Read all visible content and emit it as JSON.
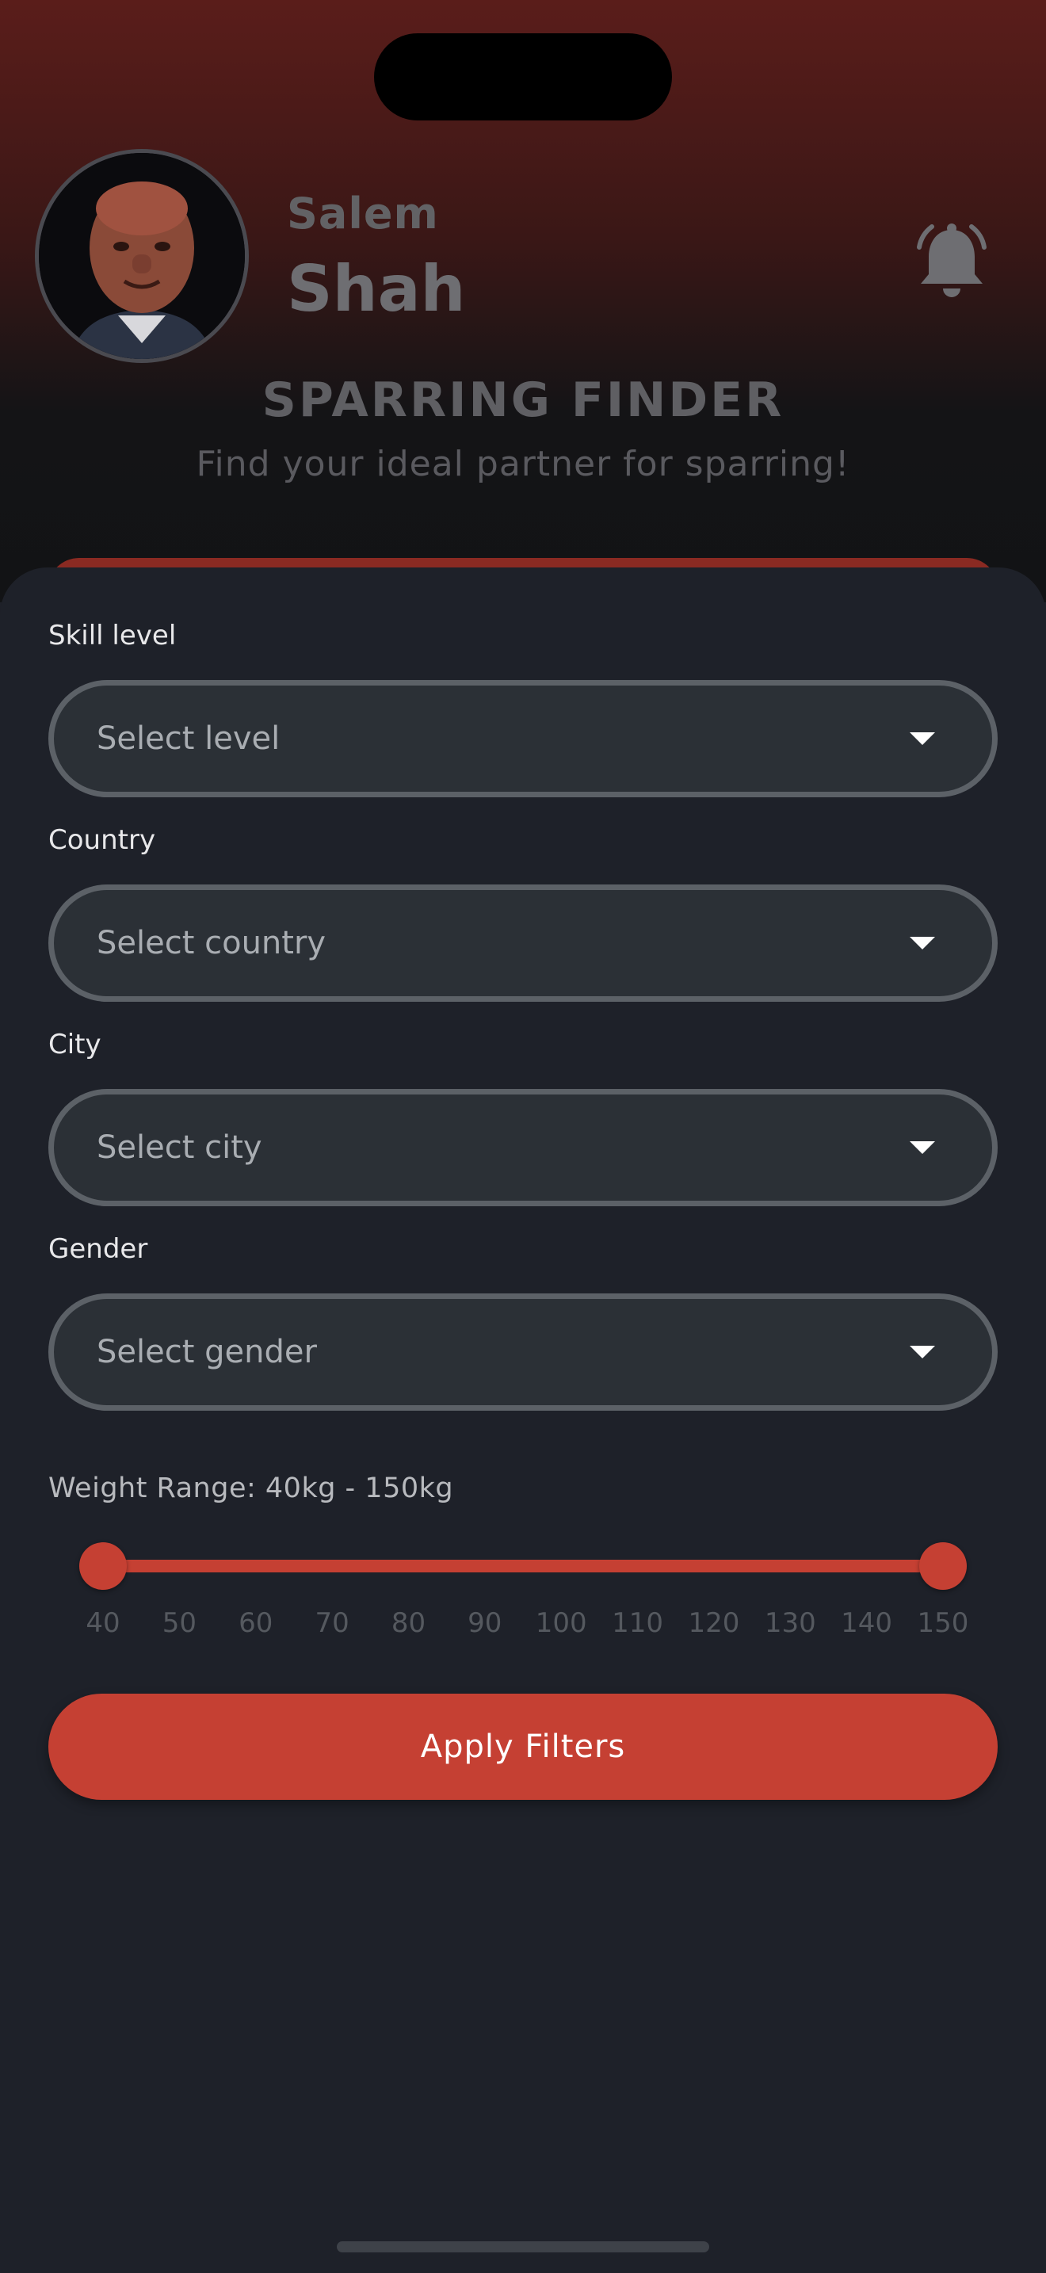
{
  "profile": {
    "first_name": "Salem",
    "last_name": "Shah"
  },
  "header": {
    "title": "SPARRING FINDER",
    "subtitle": "Find your ideal partner for sparring!"
  },
  "filters": {
    "skill": {
      "label": "Skill level",
      "placeholder": "Select level"
    },
    "country": {
      "label": "Country",
      "placeholder": "Select country"
    },
    "city": {
      "label": "City",
      "placeholder": "Select city"
    },
    "gender": {
      "label": "Gender",
      "placeholder": "Select gender"
    }
  },
  "weight": {
    "label": "Weight Range: 40kg - 150kg",
    "min": 40,
    "max": 150,
    "selected_min": 40,
    "selected_max": 150,
    "ticks": [
      "40",
      "50",
      "60",
      "70",
      "80",
      "90",
      "100",
      "110",
      "120",
      "130",
      "140",
      "150"
    ]
  },
  "apply_label": "Apply Filters",
  "colors": {
    "accent": "#c54033",
    "sheet": "#1e2129",
    "field": "#2b3036"
  },
  "icons": {
    "bell": "bell-icon",
    "dropdown": "chevron-down-icon"
  }
}
